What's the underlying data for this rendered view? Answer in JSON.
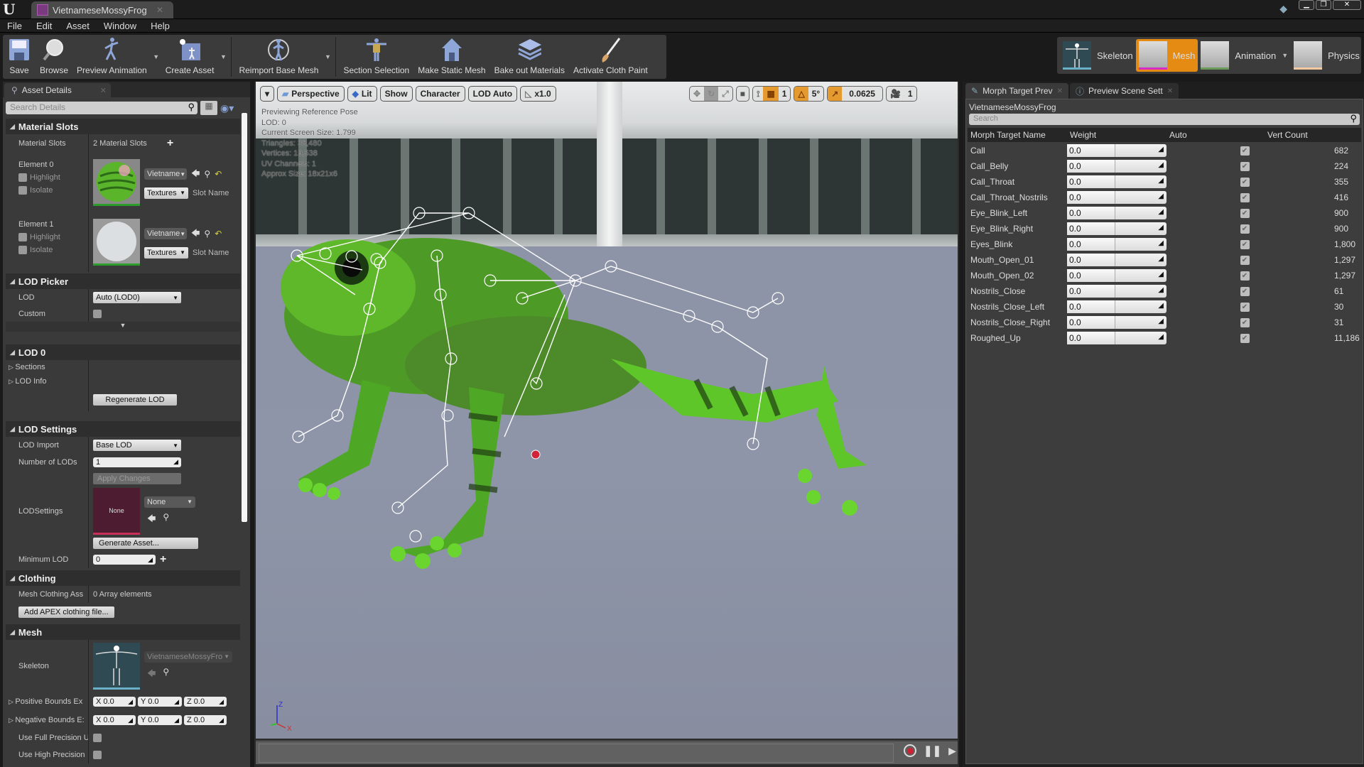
{
  "window": {
    "doc_tab": "VietnameseMossyFrog",
    "menu": [
      "File",
      "Edit",
      "Asset",
      "Window",
      "Help"
    ]
  },
  "toolbar": {
    "buttons": [
      {
        "label": "Save",
        "icon": "save-icon"
      },
      {
        "label": "Browse",
        "icon": "browse-icon"
      },
      {
        "label": "Preview Animation",
        "icon": "preview-animation-icon",
        "dropdown": true
      },
      {
        "label": "Create Asset",
        "icon": "create-asset-icon",
        "dropdown": true
      },
      {
        "label": "Reimport Base Mesh",
        "icon": "reimport-icon",
        "dropdown": true
      },
      {
        "label": "Section Selection",
        "icon": "section-selection-icon"
      },
      {
        "label": "Make Static Mesh",
        "icon": "make-static-mesh-icon"
      },
      {
        "label": "Bake out Materials",
        "icon": "bake-materials-icon"
      },
      {
        "label": "Activate Cloth Paint",
        "icon": "cloth-paint-icon"
      }
    ],
    "modes": [
      {
        "label": "Skeleton",
        "active": false
      },
      {
        "label": "Mesh",
        "active": true
      },
      {
        "label": "Animation",
        "active": false
      },
      {
        "label": "Physics",
        "active": false
      }
    ]
  },
  "details": {
    "tab": "Asset Details",
    "search_placeholder": "Search Details",
    "material_slots": {
      "header": "Material Slots",
      "label": "Material Slots",
      "count": "2 Material Slots",
      "elements": [
        {
          "label": "Element 0",
          "highlight": "Highlight",
          "isolate": "Isolate",
          "material": "Vietname",
          "textures": "Textures",
          "slot_name": "Slot Name"
        },
        {
          "label": "Element 1",
          "highlight": "Highlight",
          "isolate": "Isolate",
          "material": "Vietname",
          "textures": "Textures",
          "slot_name": "Slot Name"
        }
      ]
    },
    "lod_picker": {
      "header": "LOD Picker",
      "lod_label": "LOD",
      "lod_value": "Auto (LOD0)",
      "custom_label": "Custom"
    },
    "lod0": {
      "header": "LOD 0",
      "sections": "Sections",
      "lod_info": "LOD Info",
      "regenerate": "Regenerate LOD"
    },
    "lod_settings": {
      "header": "LOD Settings",
      "lod_import_label": "LOD Import",
      "lod_import_value": "Base LOD",
      "num_lods_label": "Number of LODs",
      "num_lods_value": "1",
      "apply": "Apply Changes",
      "lodsettings_label": "LODSettings",
      "lodsettings_thumb": "None",
      "lodsettings_value": "None",
      "generate": "Generate Asset...",
      "min_lod_label": "Minimum LOD",
      "min_lod_value": "0"
    },
    "clothing": {
      "header": "Clothing",
      "assets_label": "Mesh Clothing Ass",
      "assets_value": "0 Array elements",
      "add_apex": "Add APEX clothing file..."
    },
    "mesh": {
      "header": "Mesh",
      "skeleton_label": "Skeleton",
      "skeleton_value": "VietnameseMossyFro",
      "pos_bounds_label": "Positive Bounds Ex",
      "neg_bounds_label": "Negative Bounds E:",
      "pos_bounds": {
        "x": "0.0",
        "y": "0.0",
        "z": "0.0"
      },
      "neg_bounds": {
        "x": "0.0",
        "y": "0.0",
        "z": "0.0"
      },
      "full_precision_label": "Use Full Precision U",
      "high_precision_label": "Use High Precision"
    }
  },
  "viewport": {
    "buttons": {
      "perspective": "Perspective",
      "lit": "Lit",
      "show": "Show",
      "character": "Character",
      "lod": "LOD Auto",
      "speed": "x1.0"
    },
    "snap": {
      "grid": "1",
      "rotation": "5°",
      "scale": "0.0625",
      "camera_speed": "1"
    },
    "info": [
      "Previewing Reference Pose",
      "LOD: 0",
      "Current Screen Size: 1.799",
      "Triangles: 36,480",
      "Vertices: 19,538",
      "UV Channels: 1",
      "Approx Size: 18x21x6"
    ],
    "axis": {
      "z": "Z",
      "x": "X"
    }
  },
  "morph": {
    "tabs": [
      "Morph Target Prev",
      "Preview Scene Sett"
    ],
    "asset": "VietnameseMossyFrog",
    "search_placeholder": "Search",
    "columns": [
      "Morph Target Name",
      "Weight",
      "Auto",
      "Vert Count"
    ],
    "rows": [
      {
        "name": "Call",
        "weight": "0.0",
        "auto": true,
        "verts": "682"
      },
      {
        "name": "Call_Belly",
        "weight": "0.0",
        "auto": true,
        "verts": "224"
      },
      {
        "name": "Call_Throat",
        "weight": "0.0",
        "auto": true,
        "verts": "355"
      },
      {
        "name": "Call_Throat_Nostrils",
        "weight": "0.0",
        "auto": true,
        "verts": "416"
      },
      {
        "name": "Eye_Blink_Left",
        "weight": "0.0",
        "auto": true,
        "verts": "900"
      },
      {
        "name": "Eye_Blink_Right",
        "weight": "0.0",
        "auto": true,
        "verts": "900"
      },
      {
        "name": "Eyes_Blink",
        "weight": "0.0",
        "auto": true,
        "verts": "1,800"
      },
      {
        "name": "Mouth_Open_01",
        "weight": "0.0",
        "auto": true,
        "verts": "1,297"
      },
      {
        "name": "Mouth_Open_02",
        "weight": "0.0",
        "auto": true,
        "verts": "1,297"
      },
      {
        "name": "Nostrils_Close",
        "weight": "0.0",
        "auto": true,
        "verts": "61"
      },
      {
        "name": "Nostrils_Close_Left",
        "weight": "0.0",
        "auto": true,
        "verts": "30"
      },
      {
        "name": "Nostrils_Close_Right",
        "weight": "0.0",
        "auto": true,
        "verts": "31"
      },
      {
        "name": "Roughed_Up",
        "weight": "0.0",
        "auto": true,
        "verts": "11,186"
      }
    ]
  },
  "colors": {
    "accent": "#e58a13",
    "frog_green": "#5fc62a",
    "selected_bone": "#d0243a"
  }
}
